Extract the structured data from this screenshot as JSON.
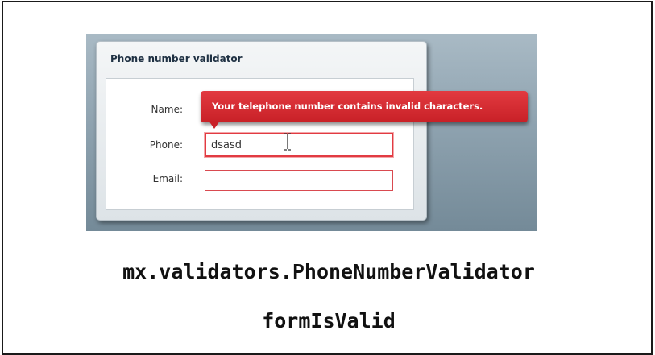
{
  "panel": {
    "title": "Phone number validator"
  },
  "form": {
    "name_label": "Name:",
    "phone_label": "Phone:",
    "email_label": "Email:",
    "phone_value": "dsasd",
    "email_value": ""
  },
  "tooltip": {
    "message": "Your telephone number contains invalid characters."
  },
  "caption": {
    "class_name": "mx.validators.PhoneNumberValidator",
    "method_name": "formIsValid"
  },
  "colors": {
    "error_red": "#d1252c",
    "title_navy": "#1f3143",
    "stage_blue_gray": "#8fa3b0"
  },
  "icons": {
    "cursor": "ibeam-cursor-icon"
  }
}
